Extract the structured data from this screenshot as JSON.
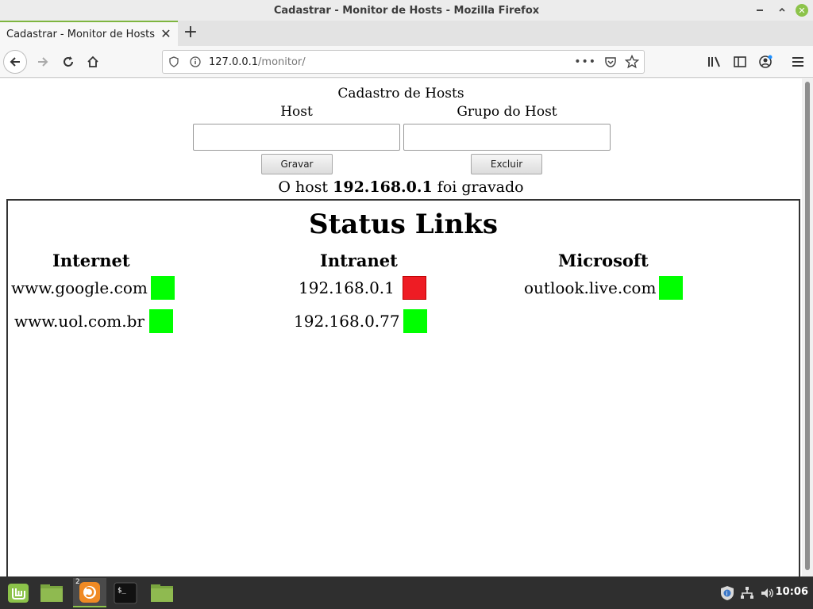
{
  "window": {
    "title": "Cadastrar - Monitor de Hosts - Mozilla Firefox"
  },
  "browser": {
    "tab_title": "Cadastrar - Monitor de Hosts",
    "url_host": "127.0.0.1",
    "url_path": "/monitor/"
  },
  "form": {
    "title": "Cadastro de Hosts",
    "host_label": "Host",
    "group_label": "Grupo do Host",
    "host_value": "",
    "group_value": "",
    "save_label": "Gravar",
    "delete_label": "Excluir",
    "message_prefix": "O host",
    "message_host": "192.168.0.1",
    "message_suffix": "foi gravado"
  },
  "status": {
    "title": "Status Links",
    "groups": [
      {
        "name": "Internet",
        "hosts": [
          {
            "name": "www.google.com",
            "status": "up"
          },
          {
            "name": "www.uol.com.br",
            "status": "up"
          }
        ]
      },
      {
        "name": "Intranet",
        "hosts": [
          {
            "name": "192.168.0.1",
            "status": "down"
          },
          {
            "name": "192.168.0.77",
            "status": "up"
          }
        ]
      },
      {
        "name": "Microsoft",
        "hosts": [
          {
            "name": "outlook.live.com",
            "status": "up"
          }
        ]
      }
    ],
    "colors": {
      "up": "#00ff00",
      "down": "#ee1c24"
    }
  },
  "taskbar": {
    "firefox_badge": "2",
    "clock": "10:06",
    "icons": [
      "mint-menu-icon",
      "files-folder-icon",
      "firefox-icon",
      "terminal-icon",
      "folder-icon"
    ],
    "tray": [
      "shield-update-icon",
      "network-icon",
      "volume-icon"
    ]
  }
}
